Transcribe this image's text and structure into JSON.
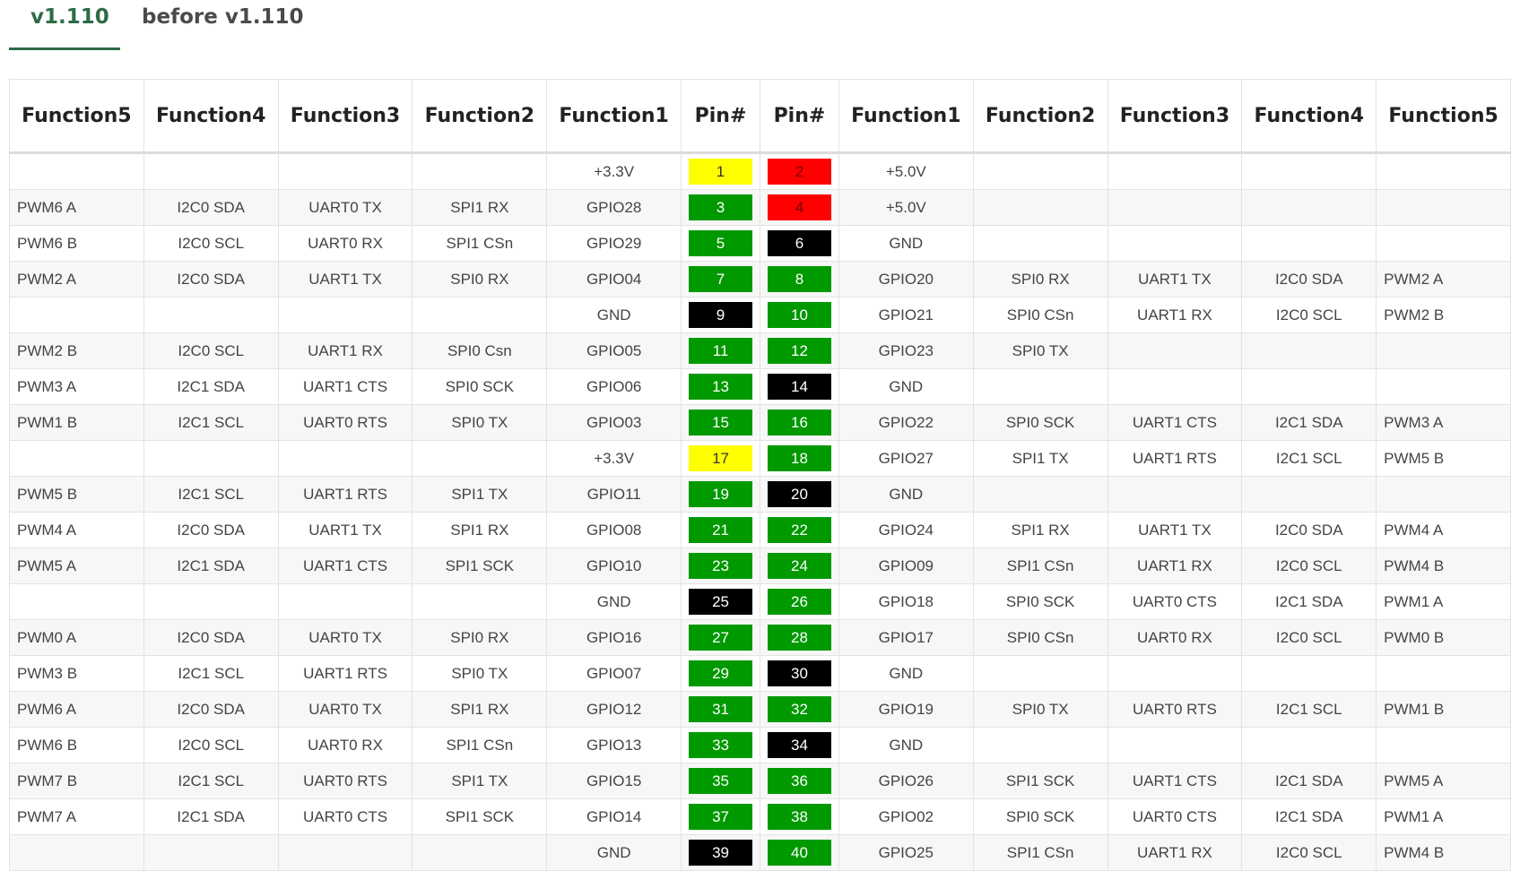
{
  "tabs": [
    {
      "label": "v1.110",
      "active": true
    },
    {
      "label": "before v1.110",
      "active": false
    }
  ],
  "headers": [
    "Function5",
    "Function4",
    "Function3",
    "Function2",
    "Function1",
    "Pin#",
    "Pin#",
    "Function1",
    "Function2",
    "Function3",
    "Function4",
    "Function5"
  ],
  "colors": {
    "yellow": "#ffff00",
    "red": "#ff0000",
    "green": "#009900",
    "black": "#000000",
    "accent": "#2e6b47"
  },
  "rows": [
    {
      "left": [
        "",
        "",
        "",
        "",
        "+3.3V"
      ],
      "lpin": "1",
      "lcolor": "yellow",
      "rpin": "2",
      "rcolor": "red",
      "right": [
        "+5.0V",
        "",
        "",
        "",
        ""
      ]
    },
    {
      "left": [
        "PWM6 A",
        "I2C0 SDA",
        "UART0 TX",
        "SPI1 RX",
        "GPIO28"
      ],
      "lpin": "3",
      "lcolor": "green",
      "rpin": "4",
      "rcolor": "red",
      "right": [
        "+5.0V",
        "",
        "",
        "",
        ""
      ]
    },
    {
      "left": [
        "PWM6 B",
        "I2C0 SCL",
        "UART0 RX",
        "SPI1 CSn",
        "GPIO29"
      ],
      "lpin": "5",
      "lcolor": "green",
      "rpin": "6",
      "rcolor": "black",
      "right": [
        "GND",
        "",
        "",
        "",
        ""
      ]
    },
    {
      "left": [
        "PWM2 A",
        "I2C0 SDA",
        "UART1 TX",
        "SPI0 RX",
        "GPIO04"
      ],
      "lpin": "7",
      "lcolor": "green",
      "rpin": "8",
      "rcolor": "green",
      "right": [
        "GPIO20",
        "SPI0 RX",
        "UART1 TX",
        "I2C0 SDA",
        "PWM2 A"
      ]
    },
    {
      "left": [
        "",
        "",
        "",
        "",
        "GND"
      ],
      "lpin": "9",
      "lcolor": "black",
      "rpin": "10",
      "rcolor": "green",
      "right": [
        "GPIO21",
        "SPI0 CSn",
        "UART1 RX",
        "I2C0 SCL",
        "PWM2 B"
      ]
    },
    {
      "left": [
        "PWM2 B",
        "I2C0 SCL",
        "UART1 RX",
        "SPI0 Csn",
        "GPIO05"
      ],
      "lpin": "11",
      "lcolor": "green",
      "rpin": "12",
      "rcolor": "green",
      "right": [
        "GPIO23",
        "SPI0 TX",
        "",
        "",
        ""
      ]
    },
    {
      "left": [
        "PWM3 A",
        "I2C1 SDA",
        "UART1 CTS",
        "SPI0 SCK",
        "GPIO06"
      ],
      "lpin": "13",
      "lcolor": "green",
      "rpin": "14",
      "rcolor": "black",
      "right": [
        "GND",
        "",
        "",
        "",
        ""
      ]
    },
    {
      "left": [
        "PWM1 B",
        "I2C1 SCL",
        "UART0 RTS",
        "SPI0 TX",
        "GPIO03"
      ],
      "lpin": "15",
      "lcolor": "green",
      "rpin": "16",
      "rcolor": "green",
      "right": [
        "GPIO22",
        "SPI0 SCK",
        "UART1 CTS",
        "I2C1 SDA",
        "PWM3 A"
      ]
    },
    {
      "left": [
        "",
        "",
        "",
        "",
        "+3.3V"
      ],
      "lpin": "17",
      "lcolor": "yellow",
      "rpin": "18",
      "rcolor": "green",
      "right": [
        "GPIO27",
        "SPI1 TX",
        "UART1 RTS",
        "I2C1 SCL",
        "PWM5 B"
      ]
    },
    {
      "left": [
        "PWM5 B",
        "I2C1 SCL",
        "UART1 RTS",
        "SPI1 TX",
        "GPIO11"
      ],
      "lpin": "19",
      "lcolor": "green",
      "rpin": "20",
      "rcolor": "black",
      "right": [
        "GND",
        "",
        "",
        "",
        ""
      ]
    },
    {
      "left": [
        "PWM4 A",
        "I2C0 SDA",
        "UART1 TX",
        "SPI1 RX",
        "GPIO08"
      ],
      "lpin": "21",
      "lcolor": "green",
      "rpin": "22",
      "rcolor": "green",
      "right": [
        "GPIO24",
        "SPI1 RX",
        "UART1 TX",
        "I2C0 SDA",
        "PWM4 A"
      ]
    },
    {
      "left": [
        "PWM5 A",
        "I2C1 SDA",
        "UART1 CTS",
        "SPI1 SCK",
        "GPIO10"
      ],
      "lpin": "23",
      "lcolor": "green",
      "rpin": "24",
      "rcolor": "green",
      "right": [
        "GPIO09",
        "SPI1 CSn",
        "UART1 RX",
        "I2C0 SCL",
        "PWM4 B"
      ]
    },
    {
      "left": [
        "",
        "",
        "",
        "",
        "GND"
      ],
      "lpin": "25",
      "lcolor": "black",
      "rpin": "26",
      "rcolor": "green",
      "right": [
        "GPIO18",
        "SPI0 SCK",
        "UART0 CTS",
        "I2C1 SDA",
        "PWM1 A"
      ]
    },
    {
      "left": [
        "PWM0 A",
        "I2C0 SDA",
        "UART0 TX",
        "SPI0 RX",
        "GPIO16"
      ],
      "lpin": "27",
      "lcolor": "green",
      "rpin": "28",
      "rcolor": "green",
      "right": [
        "GPIO17",
        "SPI0 CSn",
        "UART0 RX",
        "I2C0 SCL",
        "PWM0 B"
      ]
    },
    {
      "left": [
        "PWM3 B",
        "I2C1 SCL",
        "UART1 RTS",
        "SPI0 TX",
        "GPIO07"
      ],
      "lpin": "29",
      "lcolor": "green",
      "rpin": "30",
      "rcolor": "black",
      "right": [
        "GND",
        "",
        "",
        "",
        ""
      ]
    },
    {
      "left": [
        "PWM6 A",
        "I2C0 SDA",
        "UART0 TX",
        "SPI1 RX",
        "GPIO12"
      ],
      "lpin": "31",
      "lcolor": "green",
      "rpin": "32",
      "rcolor": "green",
      "right": [
        "GPIO19",
        "SPI0 TX",
        "UART0 RTS",
        "I2C1 SCL",
        "PWM1 B"
      ]
    },
    {
      "left": [
        "PWM6 B",
        "I2C0 SCL",
        "UART0 RX",
        "SPI1 CSn",
        "GPIO13"
      ],
      "lpin": "33",
      "lcolor": "green",
      "rpin": "34",
      "rcolor": "black",
      "right": [
        "GND",
        "",
        "",
        "",
        ""
      ]
    },
    {
      "left": [
        "PWM7 B",
        "I2C1 SCL",
        "UART0 RTS",
        "SPI1 TX",
        "GPIO15"
      ],
      "lpin": "35",
      "lcolor": "green",
      "rpin": "36",
      "rcolor": "green",
      "right": [
        "GPIO26",
        "SPI1 SCK",
        "UART1 CTS",
        "I2C1 SDA",
        "PWM5 A"
      ]
    },
    {
      "left": [
        "PWM7 A",
        "I2C1 SDA",
        "UART0 CTS",
        "SPI1 SCK",
        "GPIO14"
      ],
      "lpin": "37",
      "lcolor": "green",
      "rpin": "38",
      "rcolor": "green",
      "right": [
        "GPIO02",
        "SPI0 SCK",
        "UART0 CTS",
        "I2C1 SDA",
        "PWM1 A"
      ]
    },
    {
      "left": [
        "",
        "",
        "",
        "",
        "GND"
      ],
      "lpin": "39",
      "lcolor": "black",
      "rpin": "40",
      "rcolor": "green",
      "right": [
        "GPIO25",
        "SPI1 CSn",
        "UART1 RX",
        "I2C0 SCL",
        "PWM4 B"
      ]
    }
  ]
}
